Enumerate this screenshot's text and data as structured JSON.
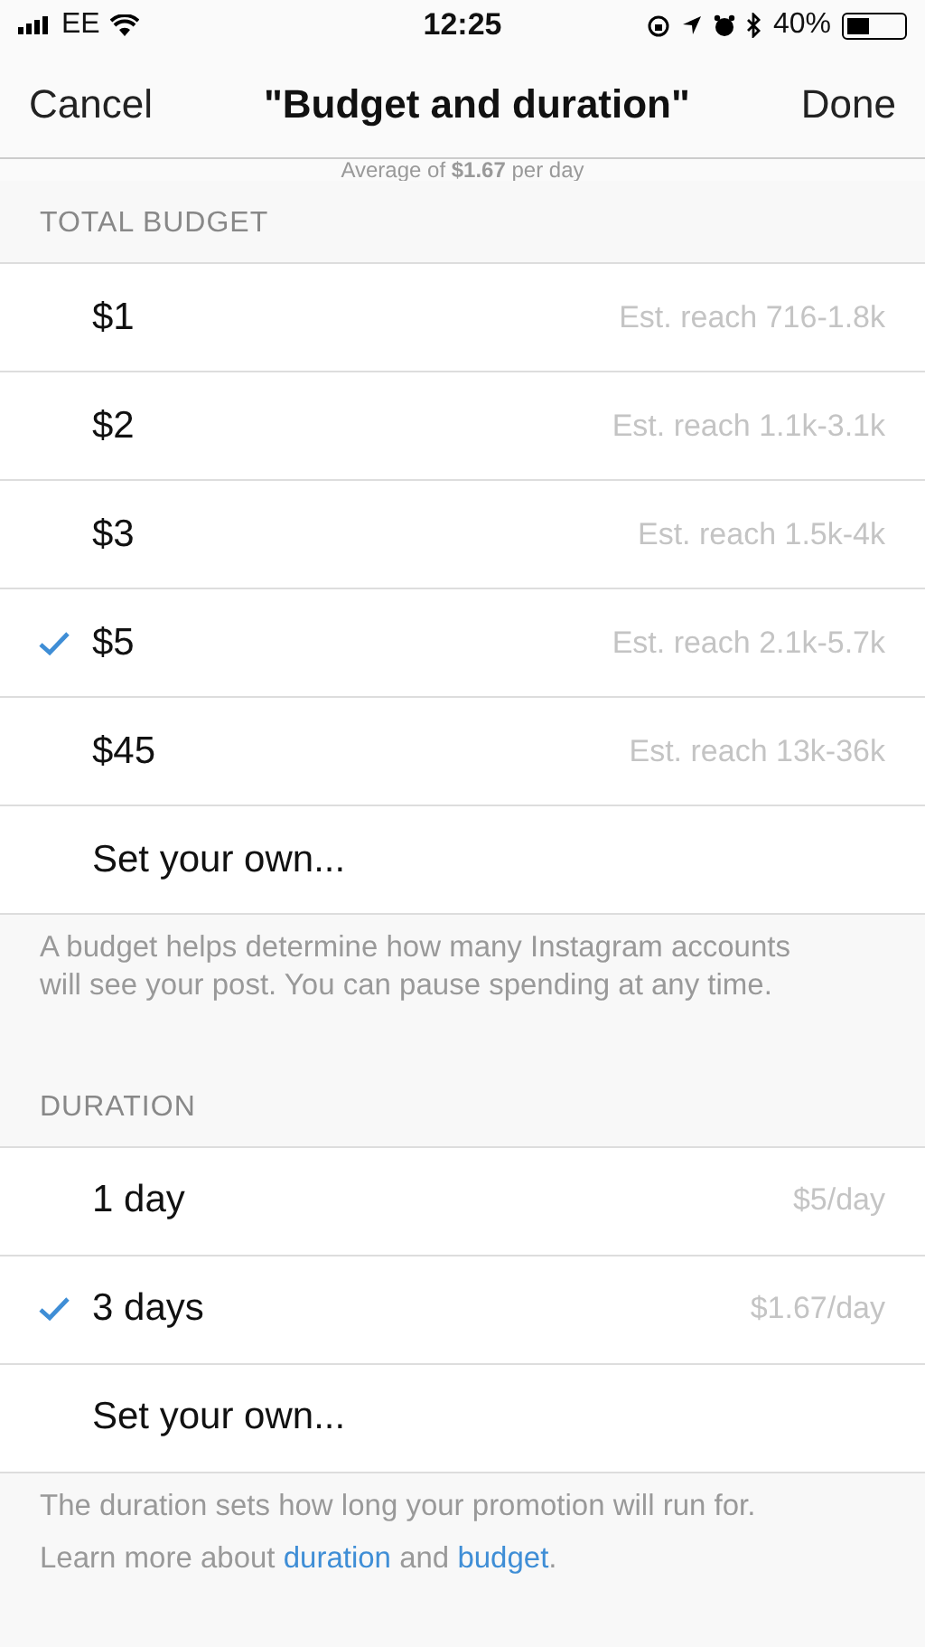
{
  "status_bar": {
    "carrier": "EE",
    "time": "12:25",
    "battery_text": "40%"
  },
  "nav": {
    "cancel": "Cancel",
    "title": "\"Budget and duration\"",
    "done": "Done"
  },
  "summary": "Average of **$1.67** per day",
  "sections": [
    {
      "header": "TOTAL BUDGET",
      "rows": [
        {
          "label": "$1",
          "detail": "Est. reach 716-1.8k",
          "selected": false
        },
        {
          "label": "$2",
          "detail": "Est. reach 1.1k-3.1k",
          "selected": false
        },
        {
          "label": "$3",
          "detail": "Est. reach 1.5k-4k",
          "selected": false
        },
        {
          "label": "$5",
          "detail": "Est. reach 2.1k-5.7k",
          "selected": true
        },
        {
          "label": "$45",
          "detail": "Est. reach 13k-36k",
          "selected": false
        },
        {
          "label": "Set your own...",
          "selected": false
        }
      ],
      "footer": [
        [
          {
            "kind": "text",
            "text": "A budget helps determine how many Instagram accounts will see your post. You can pause spending at any time."
          }
        ]
      ]
    },
    {
      "header": "DURATION",
      "rows": [
        {
          "label": "1 day",
          "detail": "$5/day",
          "selected": false
        },
        {
          "label": "3 days",
          "detail": "$1.67/day",
          "selected": true
        },
        {
          "label": "Set your own...",
          "selected": false
        }
      ],
      "footer": [
        [
          {
            "kind": "text",
            "text": "The duration sets how long your promotion will run for."
          }
        ],
        [
          {
            "kind": "text",
            "text": "Learn more about "
          },
          {
            "kind": "link",
            "text": "duration"
          },
          {
            "kind": "text",
            "text": " and "
          },
          {
            "kind": "link",
            "text": "budget"
          },
          {
            "kind": "text",
            "text": "."
          }
        ]
      ]
    }
  ]
}
